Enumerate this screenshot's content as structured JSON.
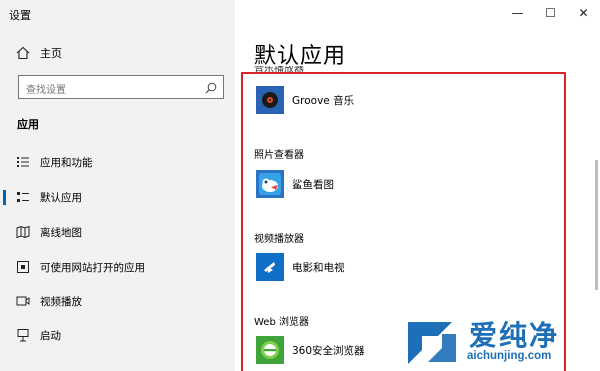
{
  "window": {
    "title": "设置",
    "controls": {
      "minimize": "—",
      "maximize": "☐",
      "close": "✕"
    }
  },
  "sidebar": {
    "home_label": "主页",
    "search_placeholder": "查找设置",
    "section_label": "应用",
    "items": [
      {
        "label": "应用和功能",
        "icon": "apps-list-icon",
        "active": false
      },
      {
        "label": "默认应用",
        "icon": "default-apps-icon",
        "active": true
      },
      {
        "label": "离线地图",
        "icon": "offline-maps-icon",
        "active": false
      },
      {
        "label": "可使用网站打开的应用",
        "icon": "open-with-web-icon",
        "active": false
      },
      {
        "label": "视频播放",
        "icon": "video-playback-icon",
        "active": false
      },
      {
        "label": "启动",
        "icon": "startup-icon",
        "active": false
      }
    ]
  },
  "main": {
    "title": "默认应用",
    "clipped_category": "音乐播放器",
    "sections": [
      {
        "category": "",
        "app": "Groove 音乐",
        "icon": "groove-music-icon"
      },
      {
        "category": "照片查看器",
        "app": "鲨鱼看图",
        "icon": "shark-viewer-icon"
      },
      {
        "category": "视频播放器",
        "app": "电影和电视",
        "icon": "movies-tv-icon"
      },
      {
        "category": "Web 浏览器",
        "app": "360安全浏览器",
        "icon": "360-browser-icon"
      }
    ]
  },
  "watermark": {
    "brand": "爱纯净",
    "url": "aichunjing.com"
  },
  "colors": {
    "accent": "#0063b1",
    "highlight_border": "#d9262b",
    "watermark": "#1d6fb8"
  }
}
